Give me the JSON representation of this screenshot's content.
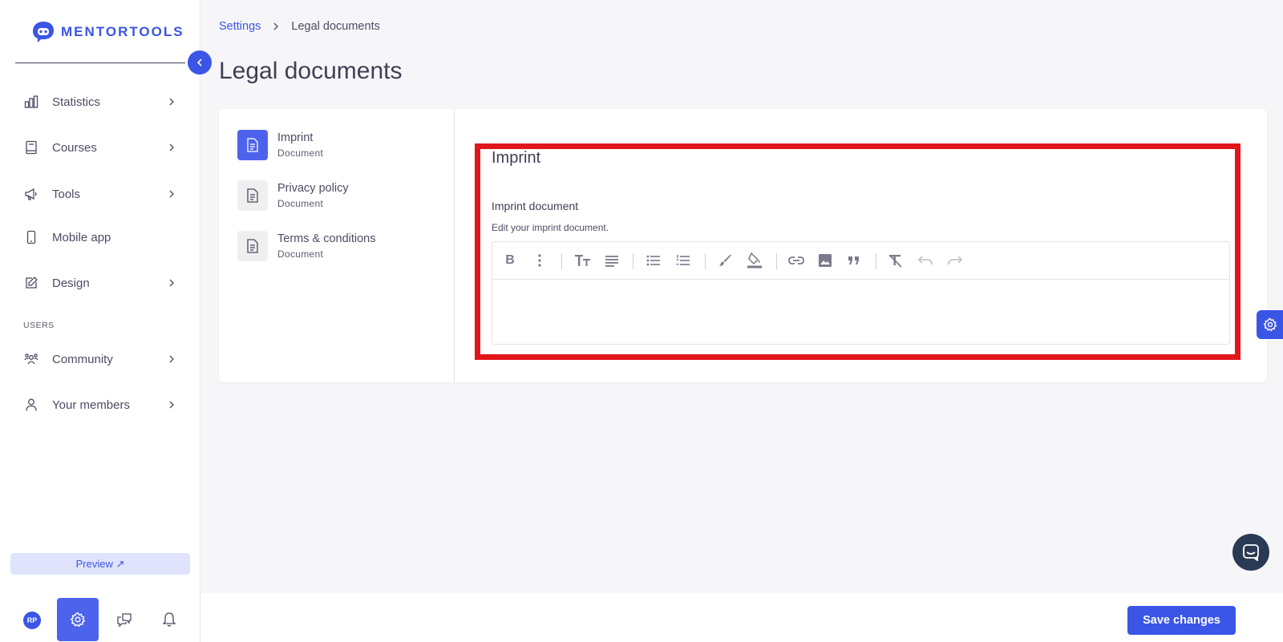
{
  "brand": {
    "name": "MENTORTOOLS"
  },
  "sidebar": {
    "items": [
      {
        "label": "Statistics",
        "icon": "bar-chart-icon",
        "has_chevron": true
      },
      {
        "label": "Courses",
        "icon": "book-icon",
        "has_chevron": true
      },
      {
        "label": "Tools",
        "icon": "megaphone-icon",
        "has_chevron": true
      },
      {
        "label": "Mobile app",
        "icon": "phone-icon",
        "has_chevron": false
      },
      {
        "label": "Design",
        "icon": "pencil-icon",
        "has_chevron": true
      }
    ],
    "users_section_label": "USERS",
    "user_items": [
      {
        "label": "Community",
        "icon": "people-icon",
        "has_chevron": true
      },
      {
        "label": "Your members",
        "icon": "person-icon",
        "has_chevron": true
      }
    ],
    "preview_label": "Preview ↗",
    "avatar_initials": "RP"
  },
  "breadcrumb": {
    "parent": "Settings",
    "current": "Legal documents"
  },
  "page": {
    "title": "Legal documents"
  },
  "documents": [
    {
      "title": "Imprint",
      "subtitle": "Document",
      "active": true
    },
    {
      "title": "Privacy policy",
      "subtitle": "Document",
      "active": false
    },
    {
      "title": "Terms & conditions",
      "subtitle": "Document",
      "active": false
    }
  ],
  "editor": {
    "title": "Imprint",
    "field_label": "Imprint document",
    "field_help": "Edit your imprint document.",
    "content": ""
  },
  "footer": {
    "save_label": "Save changes"
  },
  "colors": {
    "accent": "#3b55e6",
    "highlight": "#e0161b",
    "chat": "#2b3a54"
  }
}
